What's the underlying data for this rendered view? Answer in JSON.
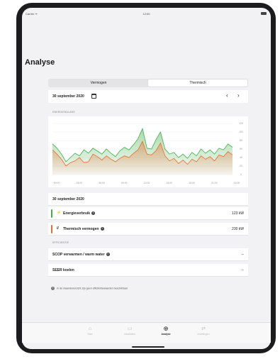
{
  "status_bar": {
    "carrier": "Carrier ᯤ",
    "time": "12:00"
  },
  "page": {
    "title": "Analyse"
  },
  "segmented": {
    "items": [
      "Vermogen",
      "Thermisch"
    ],
    "active": "Thermisch"
  },
  "date_picker": {
    "date": "30 september 2020",
    "prev": "‹",
    "next": "›"
  },
  "energy_section": {
    "label": "ENERGIEBALANS"
  },
  "chart_data": {
    "type": "area",
    "x_tick_labels": [
      "00:00",
      "03:00",
      "06:00",
      "09:00",
      "12:00",
      "15:00",
      "18:00",
      "21:00",
      "00:00"
    ],
    "y_tick_labels": [
      "0",
      "20",
      "40",
      "60",
      "80",
      "100",
      "120"
    ],
    "ylim": [
      0,
      120
    ],
    "colors": {
      "green": "#3fae49",
      "orange": "#ee6a2e"
    },
    "series": [
      {
        "color": "#3fae49",
        "values": [
          72,
          62,
          48,
          30,
          40,
          50,
          44,
          58,
          50,
          62,
          55,
          48,
          60,
          50,
          42,
          56,
          64,
          58,
          70,
          84,
          108,
          62,
          60,
          82,
          100,
          60,
          48,
          52,
          40,
          48,
          38,
          52,
          44,
          60,
          50,
          58,
          48,
          62,
          58,
          72,
          64
        ]
      },
      {
        "color": "#ee6a2e",
        "values": [
          58,
          48,
          36,
          20,
          28,
          32,
          40,
          28,
          30,
          48,
          42,
          34,
          44,
          36,
          30,
          38,
          44,
          40,
          50,
          58,
          78,
          48,
          46,
          56,
          74,
          44,
          32,
          38,
          26,
          34,
          24,
          36,
          30,
          44,
          36,
          42,
          32,
          46,
          42,
          54,
          46
        ]
      }
    ]
  },
  "summary": {
    "date": "30 september 2020",
    "rows": [
      {
        "icon": "⚡",
        "label": "Energieverbruik",
        "value": "123 kW",
        "color": "#3fae49"
      },
      {
        "icon": "//",
        "label": "Thermisch vermogen",
        "value": "230 kW",
        "color": "#ee6a2e"
      }
    ]
  },
  "efficiency": {
    "label": "EFFICIENTIE",
    "rows": [
      {
        "label": "SCOP verwarmen / warm water",
        "value": "--"
      },
      {
        "label": "SEER koelen",
        "value": "--"
      }
    ],
    "note": "In de maandoverzicht zijn geen efficiëntiewaarden beschikbaar"
  },
  "tabbar": {
    "items": [
      {
        "icon": "⌂",
        "label": "Start"
      },
      {
        "icon": "▭",
        "label": "Installaties"
      },
      {
        "icon": "◎",
        "label": "Analyse"
      },
      {
        "icon": "⇄",
        "label": "Instellingen"
      }
    ],
    "active": "Analyse"
  }
}
